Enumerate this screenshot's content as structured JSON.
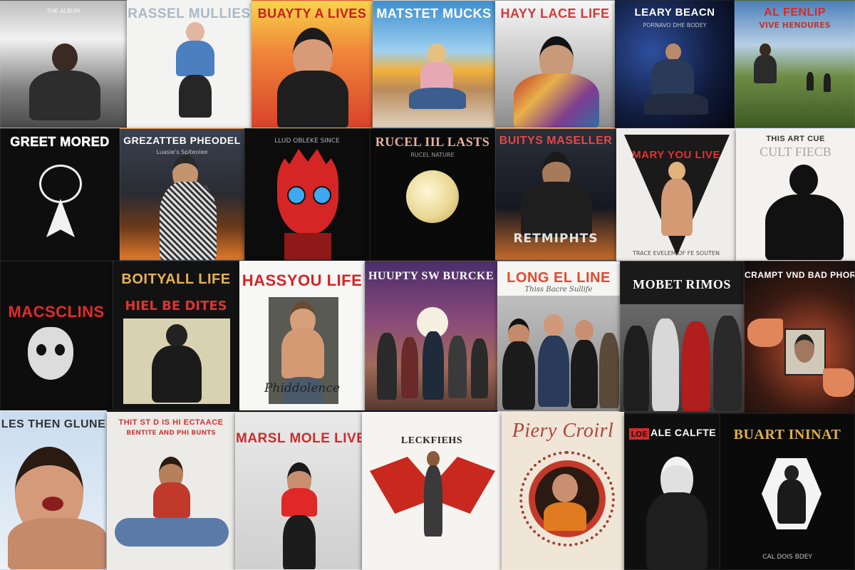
{
  "covers": [
    {
      "title": "",
      "sub": "THE ALBUM"
    },
    {
      "title": "RASSEL MULLIES",
      "sub": ""
    },
    {
      "title": "BUAYTY A LIVES",
      "sub": ""
    },
    {
      "title": "MATSTET MUCKS",
      "sub": ""
    },
    {
      "title": "HAYY LACE LIFE",
      "sub": ""
    },
    {
      "title": "LEARY BEACN",
      "sub": "PORNAVO DHE BODEY"
    },
    {
      "title": "AL FENLIP",
      "sub": "VIVE HENDURES"
    },
    {
      "title": "GREET MORED",
      "sub": ""
    },
    {
      "title": "GREZATTEB PHEODEL",
      "sub": "Luasie's Spiteolee"
    },
    {
      "title": "LLUD OBLEKE SINCE",
      "sub": ""
    },
    {
      "title": "RUCEL IIL LASTS",
      "sub": "RUCEL NATURE"
    },
    {
      "title": "BUITYS MASELLER",
      "sub": "RETMIPHTS"
    },
    {
      "title": "MARY YOU LIVE",
      "sub": "TRACE EVELEM OF FE SOUTEN"
    },
    {
      "title": "THIS ART CUE",
      "sub": "CULT FIECB"
    },
    {
      "title": "MACSCLINS",
      "sub": ""
    },
    {
      "title": "BOITYALL LIFE",
      "sub": "HIEL BE DITES"
    },
    {
      "title": "HASSYOU LIFE",
      "sub": "Phiddolence"
    },
    {
      "title": "HUUPTY SW BURCKE",
      "sub": ""
    },
    {
      "title": "LONG EL LINE",
      "sub": "Thiss Bacre Sullife"
    },
    {
      "title": "MOBET RIMOS",
      "sub": ""
    },
    {
      "title": "CRAMPT VND BAD PHORKS",
      "sub": ""
    },
    {
      "title": "LES THEN GLUNE",
      "sub": ""
    },
    {
      "title": "THIT ST D IS HI ECTAACE",
      "sub": "BENTITE AND PHI BUNTS"
    },
    {
      "title": "MARSL MOLE LIVE",
      "sub": ""
    },
    {
      "title": "LECKFIEHS",
      "sub": ""
    },
    {
      "title": "Piery Croirl",
      "sub": ""
    },
    {
      "title": "ALE CALFTE",
      "sub": "LOE"
    },
    {
      "title": "BUART ININAT",
      "sub": "CAL DOIS BDEY"
    }
  ],
  "palette": {
    "red": "#e8312b",
    "cream": "#f4efe6",
    "gold": "#e0b04a"
  }
}
